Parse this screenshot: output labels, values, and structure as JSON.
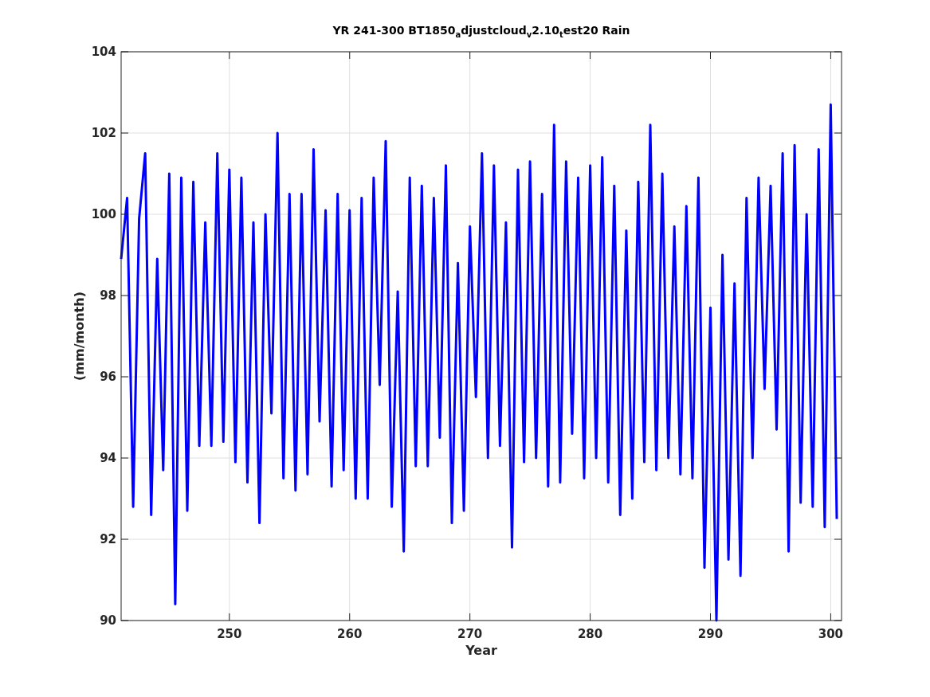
{
  "chart": {
    "chart_data": {
      "type": "line",
      "title": "YR 241-300 BT1850$_{a}$djustcloud$_{v}$2.10$_{t}$est20 Rain",
      "xlabel": "Year",
      "ylabel": "(mm/month)",
      "grid": true,
      "xlim": [
        241,
        300.9
      ],
      "ylim": [
        90,
        104
      ],
      "xticks": [
        250,
        260,
        270,
        280,
        290,
        300
      ],
      "yticks": [
        90,
        92,
        94,
        96,
        98,
        100,
        102,
        104
      ],
      "x": [
        241,
        241.5,
        242,
        242.5,
        243,
        243.5,
        244,
        244.5,
        245,
        245.5,
        246,
        246.5,
        247,
        247.5,
        248,
        248.5,
        249,
        249.5,
        250,
        250.5,
        251,
        251.5,
        252,
        252.5,
        253,
        253.5,
        254,
        254.5,
        255,
        255.5,
        256,
        256.5,
        257,
        257.5,
        258,
        258.5,
        259,
        259.5,
        260,
        260.5,
        261,
        261.5,
        262,
        262.5,
        263,
        263.5,
        264,
        264.5,
        265,
        265.5,
        266,
        266.5,
        267,
        267.5,
        268,
        268.5,
        269,
        269.5,
        270,
        270.5,
        271,
        271.5,
        272,
        272.5,
        273,
        273.5,
        274,
        274.5,
        275,
        275.5,
        276,
        276.5,
        277,
        277.5,
        278,
        278.5,
        279,
        279.5,
        280,
        280.5,
        281,
        281.5,
        282,
        282.5,
        283,
        283.5,
        284,
        284.5,
        285,
        285.5,
        286,
        286.5,
        287,
        287.5,
        288,
        288.5,
        289,
        289.5,
        290,
        290.5,
        291,
        291.5,
        292,
        292.5,
        293,
        293.5,
        294,
        294.5,
        295,
        295.5,
        296,
        296.5,
        297,
        297.5,
        298,
        298.5,
        299,
        299.5,
        300,
        300.5
      ],
      "series": [
        {
          "color": "#0000ff",
          "values": [
            98.9,
            100.4,
            92.8,
            99.9,
            101.5,
            92.6,
            98.9,
            93.7,
            101.0,
            90.4,
            100.9,
            92.7,
            100.8,
            94.3,
            99.8,
            94.3,
            101.5,
            94.4,
            101.1,
            93.9,
            100.9,
            93.4,
            99.8,
            92.4,
            100.0,
            95.1,
            102.0,
            93.5,
            100.5,
            93.2,
            100.5,
            93.6,
            101.6,
            94.9,
            100.1,
            93.3,
            100.5,
            93.7,
            100.1,
            93.0,
            100.4,
            93.0,
            100.9,
            95.8,
            101.8,
            92.8,
            98.1,
            91.7,
            100.9,
            93.8,
            100.7,
            93.8,
            100.4,
            94.5,
            101.2,
            92.4,
            98.8,
            92.7,
            99.7,
            95.5,
            101.5,
            94.0,
            101.2,
            94.3,
            99.8,
            91.8,
            101.1,
            93.9,
            101.3,
            94.0,
            100.5,
            93.3,
            102.2,
            93.4,
            101.3,
            94.6,
            100.9,
            93.5,
            101.2,
            94.0,
            101.4,
            93.4,
            100.7,
            92.6,
            99.6,
            93.0,
            100.8,
            93.9,
            102.2,
            93.7,
            101.0,
            94.0,
            99.7,
            93.6,
            100.2,
            93.5,
            100.9,
            91.3,
            97.7,
            90.0,
            99.0,
            91.5,
            98.3,
            91.1,
            100.4,
            94.0,
            100.9,
            95.7,
            100.7,
            94.7,
            101.5,
            91.7,
            101.7,
            92.9,
            100.0,
            92.8,
            101.6,
            92.3,
            102.7,
            92.5
          ]
        }
      ]
    }
  }
}
